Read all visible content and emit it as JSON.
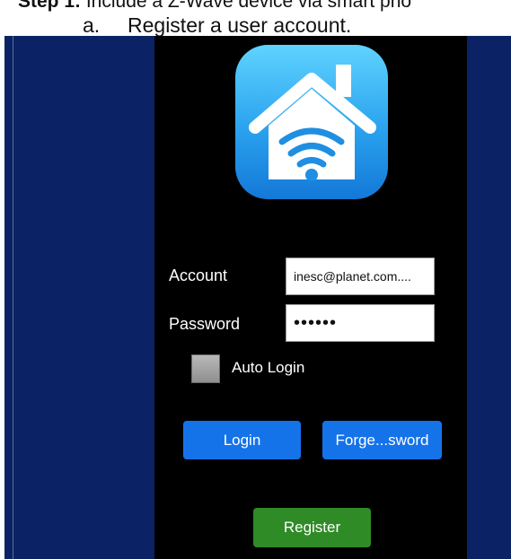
{
  "document": {
    "step_bold": "Step 1:",
    "step_text": " Include a Z-Wave device via smart pho",
    "substep_number": "a.",
    "substep_text": "Register a user account."
  },
  "app": {
    "icon": "smart-home-wifi-icon",
    "account_label": "Account",
    "account_value": "inesc@planet.com....",
    "password_label": "Password",
    "password_value": "••••••",
    "auto_login_label": "Auto Login",
    "login_button": "Login",
    "forgot_button": "Forge...sword",
    "register_button": "Register"
  },
  "colors": {
    "frame_background": "#0b2364",
    "phone_background": "#000000",
    "primary_button": "#1573ea",
    "register_button": "#2f8b26"
  }
}
